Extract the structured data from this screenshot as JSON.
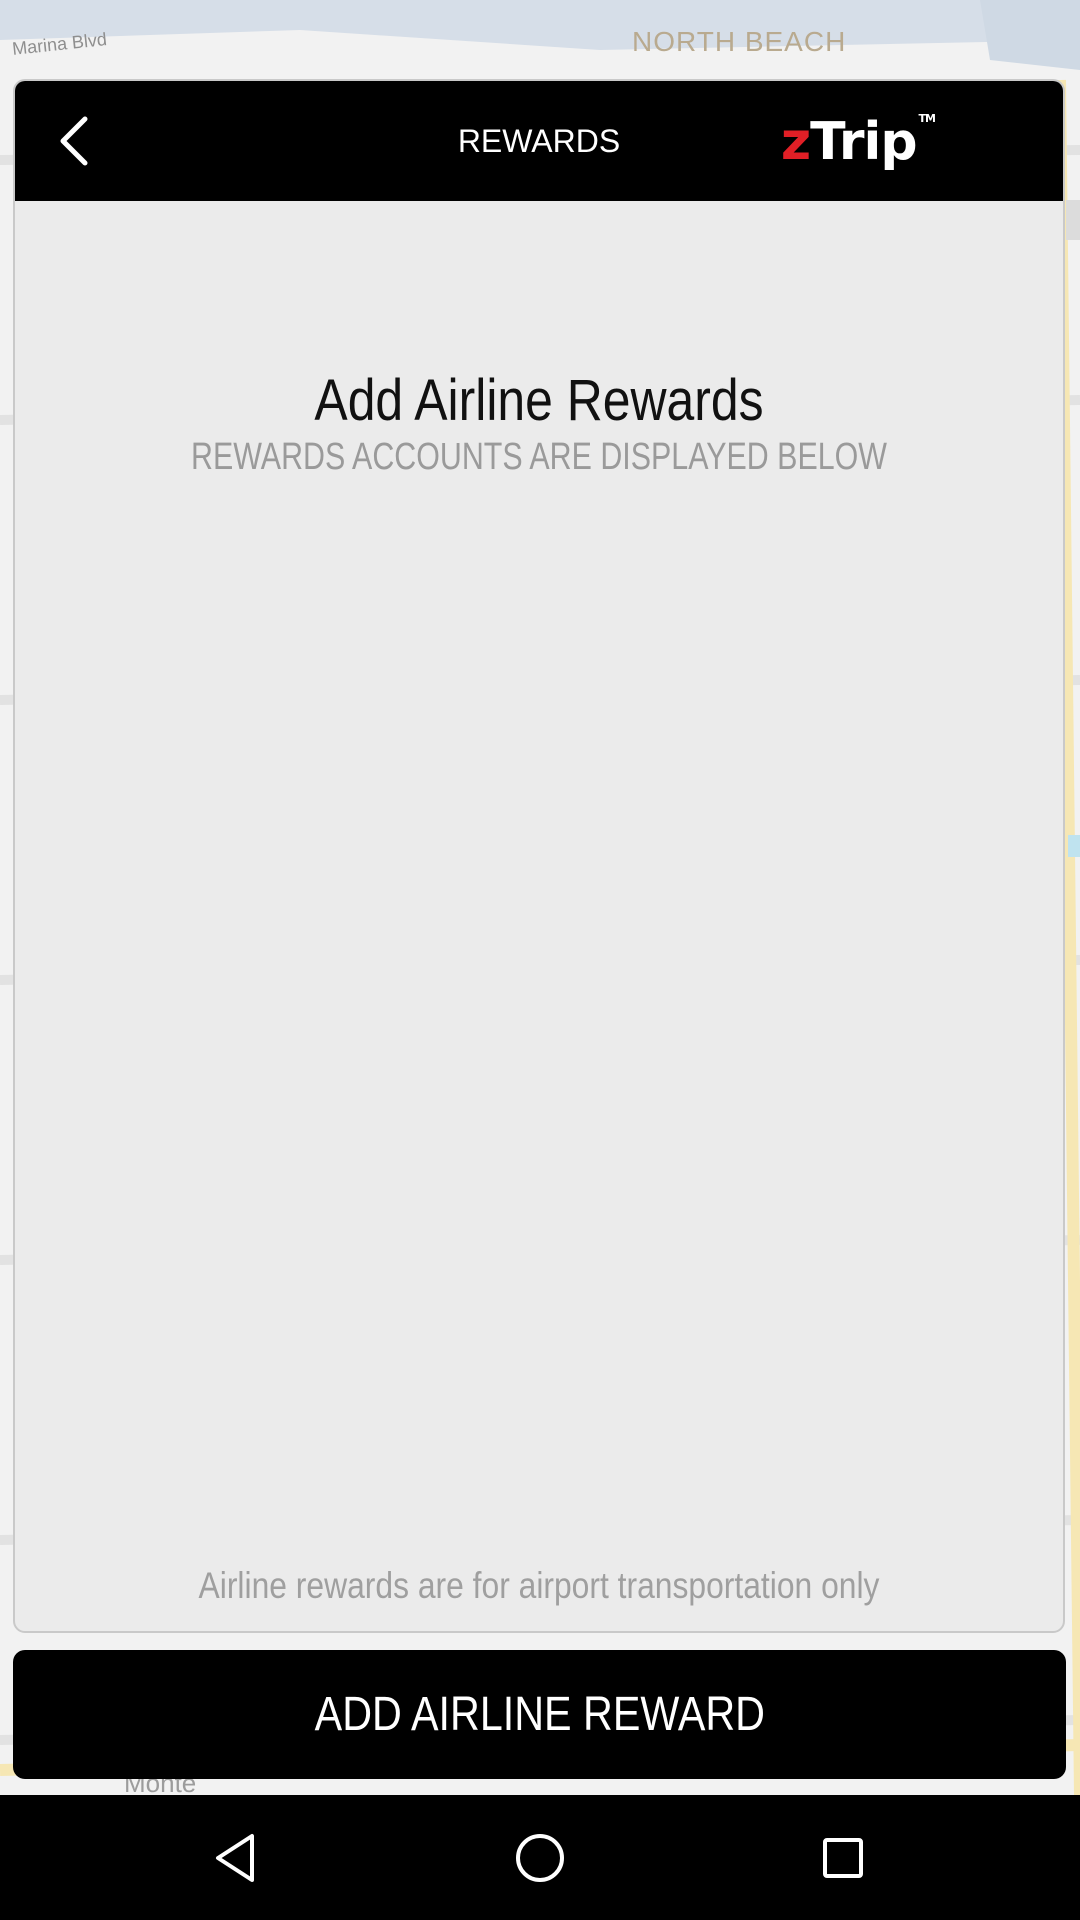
{
  "map": {
    "labels": {
      "north_beach": "NORTH BEACH",
      "marina": "Marina Blvd",
      "monte": "Monte"
    }
  },
  "header": {
    "title": "REWARDS",
    "back_icon": "chevron-left-icon",
    "logo": {
      "z": "z",
      "rest": "Trip",
      "tm": "TM"
    }
  },
  "content": {
    "heading": "Add Airline Rewards",
    "subheading": "REWARDS ACCOUNTS ARE DISPLAYED BELOW",
    "footnote": "Airline rewards are for airport transportation only"
  },
  "actions": {
    "add_button_label": "ADD AIRLINE REWARD"
  },
  "navbar": {
    "back_icon": "triangle-back-icon",
    "home_icon": "circle-home-icon",
    "recent_icon": "square-recents-icon"
  },
  "colors": {
    "brand_red": "#e11f26",
    "header_bg": "#000000",
    "card_bg": "#ebebeb"
  }
}
